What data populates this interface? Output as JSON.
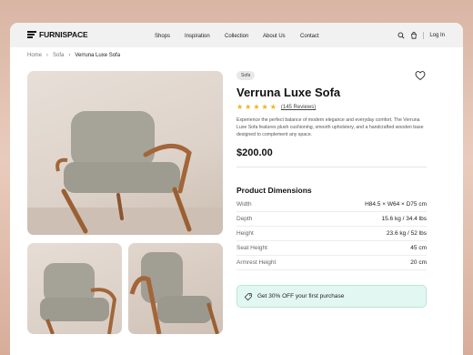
{
  "brand": {
    "name": "FURNISPACE"
  },
  "nav": {
    "items": [
      "Shops",
      "Inspiration",
      "Collection",
      "About Us",
      "Contact"
    ],
    "login": "Log In"
  },
  "breadcrumb": [
    "Home",
    "Sofa",
    "Verruna Luxe Sofa"
  ],
  "product": {
    "category": "Sofa",
    "title": "Verruna Luxe Sofa",
    "rating": 5,
    "reviews": "(145 Reviews)",
    "description": "Experience the perfect balance of modern elegance and everyday comfort. The Verruna Luxe Sofa features plush cushioning, smooth upholstery, and a handcrafted wooden base designed to complement any space.",
    "price": "$200.00"
  },
  "dimensions": {
    "title": "Product Dimensions",
    "rows": [
      {
        "label": "Width",
        "value": "H84.5 × W64 × D75 cm"
      },
      {
        "label": "Depth",
        "value": "15.6 kg / 34.4 lbs"
      },
      {
        "label": "Height",
        "value": "23.6 kg / 52 lbs"
      },
      {
        "label": "Seat Height",
        "value": "45 cm"
      },
      {
        "label": "Armrest Height",
        "value": "20 cm"
      }
    ]
  },
  "promo": {
    "text": "Get 30% OFF your first purchase"
  },
  "colors": {
    "star": "#f2b01e",
    "promo_bg": "#e3f7f2",
    "promo_border": "#b6e6da"
  }
}
